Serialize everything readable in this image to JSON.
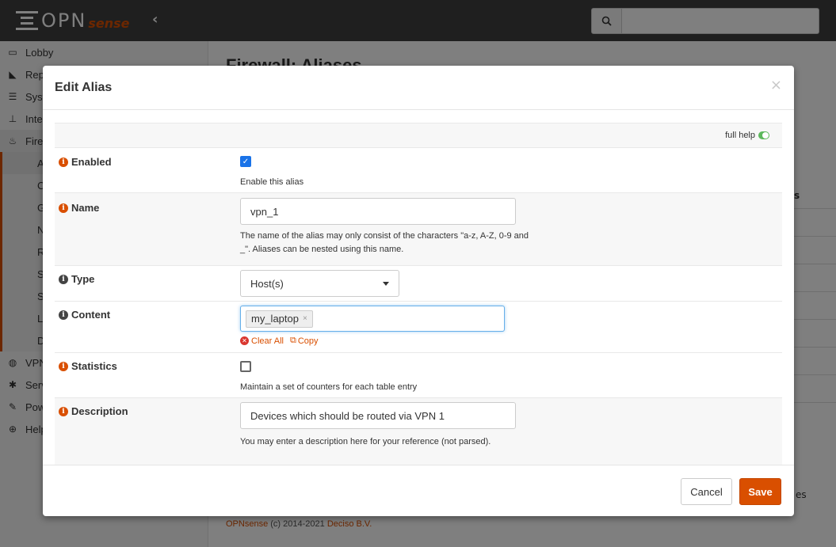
{
  "header": {
    "logo_opn": "OPN",
    "logo_sense": "sense",
    "collapse_icon": "chevron-left-icon",
    "search_placeholder": ""
  },
  "sidebar": {
    "items": [
      {
        "label": "Lobby",
        "icon": "laptop-icon"
      },
      {
        "label": "Rep",
        "icon": "area-chart-icon"
      },
      {
        "label": "Syst",
        "icon": "server-icon"
      },
      {
        "label": "Inte",
        "icon": "sitemap-icon"
      },
      {
        "label": "Fire",
        "icon": "fire-icon"
      }
    ],
    "sub_items": [
      "Al",
      "Ca",
      "G",
      "N",
      "R",
      "Sl",
      "Se",
      "Lo",
      "D"
    ],
    "items_after": [
      {
        "label": "VPN",
        "icon": "globe-icon"
      },
      {
        "label": "Serv",
        "icon": "cog-icon"
      },
      {
        "label": "Pow",
        "icon": "plug-icon"
      },
      {
        "label": "Help",
        "icon": "lifebuoy-icon"
      }
    ]
  },
  "main": {
    "title": "Firewall: Aliases",
    "right_fragment_1": "s",
    "right_fragment_2": "es",
    "footer_brand": "OPNsense",
    "footer_text": " (c) 2014-2021 ",
    "footer_company": "Deciso B.V."
  },
  "modal": {
    "title": "Edit Alias",
    "close_label": "×",
    "full_help_label": "full help",
    "fields": {
      "enabled": {
        "label": "Enabled",
        "checked": true,
        "hint": "Enable this alias"
      },
      "name": {
        "label": "Name",
        "value": "vpn_1",
        "hint_line1": "The name of the alias may only consist of the characters \"a-z, A-Z, 0-9 and",
        "hint_line2": "_\". Aliases can be nested using this name."
      },
      "type": {
        "label": "Type",
        "value": "Host(s)"
      },
      "content": {
        "label": "Content",
        "token": "my_laptop",
        "clear_all": "Clear All",
        "copy": "Copy"
      },
      "statistics": {
        "label": "Statistics",
        "checked": false,
        "hint": "Maintain a set of counters for each table entry"
      },
      "description": {
        "label": "Description",
        "value": "Devices which should be routed via VPN 1",
        "hint": "You may enter a description here for your reference (not parsed)."
      }
    },
    "footer": {
      "cancel_label": "Cancel",
      "save_label": "Save"
    }
  },
  "colors": {
    "brand_orange": "#d94f00",
    "topbar": "#3f3f3f",
    "checkbox_blue": "#1a73e8",
    "toggle_green": "#5cb85c"
  }
}
